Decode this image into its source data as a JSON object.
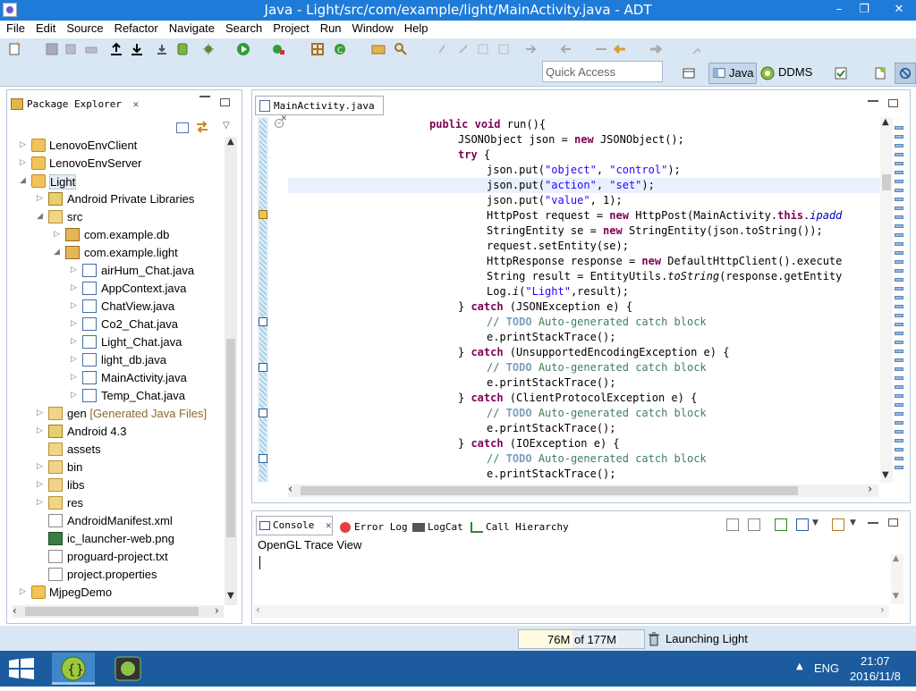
{
  "window": {
    "title": "Java - Light/src/com/example/light/MainActivity.java - ADT",
    "minimize": "–",
    "restore": "❐",
    "close": "✕"
  },
  "menu": [
    "File",
    "Edit",
    "Source",
    "Refactor",
    "Navigate",
    "Search",
    "Project",
    "Run",
    "Window",
    "Help"
  ],
  "toolbar": {
    "quick_access_placeholder": "Quick Access",
    "perspectives": [
      "Java",
      "DDMS"
    ]
  },
  "package_explorer": {
    "title": "Package Explorer",
    "items": [
      {
        "label": "LenovoEnvClient"
      },
      {
        "label": "LenovoEnvServer"
      },
      {
        "label": "Light"
      },
      {
        "label": "Android Private Libraries"
      },
      {
        "label": "src"
      },
      {
        "label": "com.example.db"
      },
      {
        "label": "com.example.light"
      },
      {
        "label": "airHum_Chat.java"
      },
      {
        "label": "AppContext.java"
      },
      {
        "label": "ChatView.java"
      },
      {
        "label": "Co2_Chat.java"
      },
      {
        "label": "Light_Chat.java"
      },
      {
        "label": "light_db.java"
      },
      {
        "label": "MainActivity.java"
      },
      {
        "label": "Temp_Chat.java"
      },
      {
        "label": "gen",
        "suffix": "[Generated Java Files]"
      },
      {
        "label": "Android 4.3"
      },
      {
        "label": "assets"
      },
      {
        "label": "bin"
      },
      {
        "label": "libs"
      },
      {
        "label": "res"
      },
      {
        "label": "AndroidManifest.xml"
      },
      {
        "label": "ic_launcher-web.png"
      },
      {
        "label": "proguard-project.txt"
      },
      {
        "label": "project.properties"
      },
      {
        "label": "MjpegDemo"
      }
    ]
  },
  "editor": {
    "tab": "MainActivity.java"
  },
  "console": {
    "tabs": [
      "Console",
      "Error Log",
      "LogCat",
      "Call Hierarchy"
    ],
    "subtitle": "OpenGL Trace View"
  },
  "status": {
    "heap_used": "76M",
    "heap_total": "of 177M",
    "message": "Launching Light"
  },
  "taskbar": {
    "lang": "ENG",
    "time": "21:07",
    "date": "2016/11/8"
  }
}
